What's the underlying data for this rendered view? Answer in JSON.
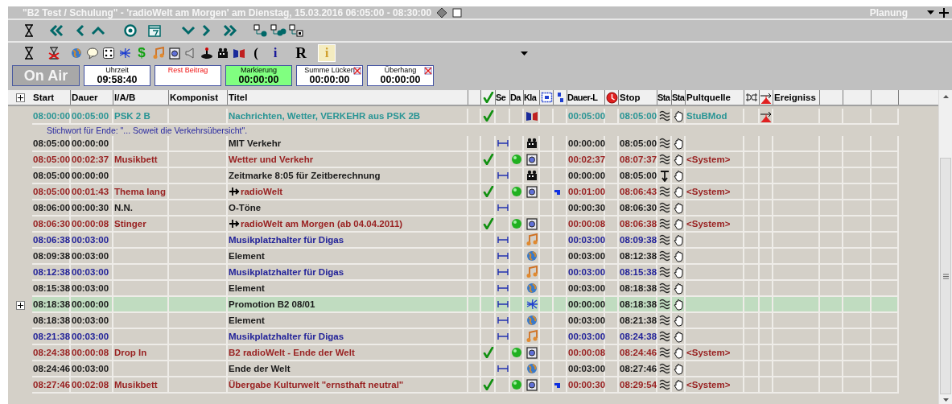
{
  "window": {
    "title": "\"B2 Test / Schulung\" - 'radioWelt am Morgen' am Dienstag, 15.03.2016 06:05:00 - 08:30:00",
    "view": "Planung"
  },
  "toolbar_2": {
    "glyphs": [
      {
        "text": "$",
        "kind": "dollar"
      },
      {
        "text": "(",
        "kind": "paren"
      },
      {
        "text": "i",
        "kind": "info"
      },
      {
        "text": "R",
        "kind": "letter"
      },
      {
        "text": "i",
        "kind": "info-active"
      }
    ]
  },
  "status": {
    "on_air": "On Air",
    "boxes": [
      {
        "label": "Uhrzeit",
        "value": "09:58:40",
        "alert": false,
        "closable": false,
        "color": "#ffffff"
      },
      {
        "label": "Rest Beitrag",
        "alert": true,
        "closable": false,
        "color": "#ffffff"
      },
      {
        "label": "Markierung",
        "value": "00:00:00",
        "alert": false,
        "closable": false,
        "color": "#80ff80"
      },
      {
        "label": "Summe Lücken",
        "value": "00:00:00",
        "alert": false,
        "closable": true,
        "color": "#ffffff"
      },
      {
        "label": "Überhang",
        "value": "00:00:00",
        "alert": false,
        "closable": true,
        "color": "#ffffff"
      }
    ]
  },
  "table": {
    "columns": [
      "Start",
      "Dauer",
      "I/A/B",
      "Komponist",
      "Titel",
      "Se",
      "Da",
      "Kla",
      "Dauer-L",
      "Stop",
      "Sta",
      "Sta",
      "Pultquelle",
      "Ereigniss"
    ],
    "rows": [
      {
        "start": "08:00:00",
        "duration": "00:05:00",
        "iab": "PSK 2 B",
        "title": "Nachrichten, Wetter, VERKEHR aus PSK 2B",
        "color": "#2a9595",
        "linked": false,
        "checked": true,
        "bracket": false,
        "ball": false,
        "class": {
          "kind": "flags"
        },
        "marker": false,
        "dauer_l": "00:05:00",
        "stop": "08:05:00",
        "status": {
          "kind": "wave"
        },
        "pult": "StuBMod",
        "event": true,
        "selected": false,
        "expandable": false,
        "note": "Stichwort für Ende: \"... Soweit die Verkehrsübersicht\"."
      },
      {
        "start": "08:05:00",
        "duration": "00:00:00",
        "title": "MIT Verkehr",
        "color": "#1a1a1a",
        "linked": false,
        "checked": false,
        "bracket": true,
        "ball": false,
        "class": {
          "kind": "film"
        },
        "marker": false,
        "dauer_l": "00:00:00",
        "stop": "08:05:00",
        "status": {
          "kind": "wave"
        },
        "event": false,
        "selected": false,
        "expandable": false
      },
      {
        "start": "08:05:00",
        "duration": "00:02:37",
        "iab": "Musikbett",
        "title": "Wetter und Verkehr",
        "color": "#992222",
        "linked": false,
        "checked": true,
        "bracket": false,
        "ball": true,
        "class": {
          "kind": "speakerbox"
        },
        "marker": false,
        "dauer_l": "00:02:37",
        "stop": "08:07:37",
        "status": {
          "kind": "wave"
        },
        "pult": "<System>",
        "event": false,
        "selected": false,
        "expandable": false
      },
      {
        "start": "08:05:00",
        "duration": "00:00:00",
        "title": "Zeitmarke 8:05 für Zeitberechnung",
        "color": "#1a1a1a",
        "linked": false,
        "checked": false,
        "bracket": true,
        "ball": false,
        "class": {
          "kind": "film"
        },
        "marker": false,
        "dauer_l": "00:00:00",
        "stop": "08:05:00",
        "status": {
          "kind": "timemark"
        },
        "event": false,
        "selected": false,
        "expandable": false
      },
      {
        "start": "08:05:00",
        "duration": "00:01:43",
        "iab": "Thema lang",
        "title": "radioWelt",
        "color": "#992222",
        "linked": true,
        "checked": true,
        "bracket": false,
        "ball": true,
        "class": {
          "kind": "speakerbox"
        },
        "marker": true,
        "dauer_l": "00:01:00",
        "stop": "08:06:43",
        "status": {
          "kind": "wave"
        },
        "pult": "<System>",
        "event": false,
        "selected": false,
        "expandable": false
      },
      {
        "start": "08:06:00",
        "duration": "00:00:30",
        "iab": "N.N.",
        "title": "O-Töne",
        "color": "#1a1a1a",
        "linked": false,
        "checked": false,
        "bracket": true,
        "ball": false,
        "marker": false,
        "dauer_l": "00:00:30",
        "stop": "08:06:30",
        "status": {
          "kind": "wave"
        },
        "event": false,
        "selected": false,
        "expandable": false
      },
      {
        "start": "08:06:30",
        "duration": "00:00:08",
        "iab": "Stinger",
        "title": "radioWelt am Morgen (ab 04.04.2011)",
        "color": "#992222",
        "linked": true,
        "checked": true,
        "bracket": false,
        "ball": true,
        "class": {
          "kind": "speakerbox"
        },
        "marker": false,
        "dauer_l": "00:00:08",
        "stop": "08:06:38",
        "status": {
          "kind": "wave"
        },
        "pult": "<System>",
        "event": false,
        "selected": false,
        "expandable": false
      },
      {
        "start": "08:06:38",
        "duration": "00:03:00",
        "title": "Musikplatzhalter für Digas",
        "color": "#222299",
        "linked": false,
        "checked": false,
        "bracket": true,
        "ball": false,
        "class": {
          "kind": "music"
        },
        "marker": false,
        "dauer_l": "00:03:00",
        "stop": "08:09:38",
        "status": {
          "kind": "wave"
        },
        "event": false,
        "selected": false,
        "expandable": false
      },
      {
        "start": "08:09:38",
        "duration": "00:03:00",
        "title": "Element",
        "color": "#1a1a1a",
        "linked": false,
        "checked": false,
        "bracket": true,
        "ball": false,
        "class": {
          "kind": "globe"
        },
        "marker": false,
        "dauer_l": "00:03:00",
        "stop": "08:12:38",
        "status": {
          "kind": "wave"
        },
        "event": false,
        "selected": false,
        "expandable": false
      },
      {
        "start": "08:12:38",
        "duration": "00:03:00",
        "title": "Musikplatzhalter für Digas",
        "color": "#222299",
        "linked": false,
        "checked": false,
        "bracket": true,
        "ball": false,
        "class": {
          "kind": "music"
        },
        "marker": false,
        "dauer_l": "00:03:00",
        "stop": "08:15:38",
        "status": {
          "kind": "wave"
        },
        "event": false,
        "selected": false,
        "expandable": false
      },
      {
        "start": "08:15:38",
        "duration": "00:03:00",
        "title": "Element",
        "color": "#1a1a1a",
        "linked": false,
        "checked": false,
        "bracket": true,
        "ball": false,
        "class": {
          "kind": "globe"
        },
        "marker": false,
        "dauer_l": "00:03:00",
        "stop": "08:18:38",
        "status": {
          "kind": "wave"
        },
        "event": false,
        "selected": false,
        "expandable": false
      },
      {
        "start": "08:18:38",
        "duration": "00:00:00",
        "title": "Promotion B2 08/01",
        "color": "#1a1a1a",
        "linked": false,
        "checked": false,
        "bracket": true,
        "ball": false,
        "class": {
          "kind": "burst"
        },
        "marker": false,
        "dauer_l": "00:00:00",
        "stop": "08:18:38",
        "status": {
          "kind": "wave"
        },
        "event": false,
        "selected": true,
        "expandable": true
      },
      {
        "start": "08:18:38",
        "duration": "00:03:00",
        "title": "Element",
        "color": "#1a1a1a",
        "linked": false,
        "checked": false,
        "bracket": true,
        "ball": false,
        "class": {
          "kind": "globe"
        },
        "marker": false,
        "dauer_l": "00:03:00",
        "stop": "08:21:38",
        "status": {
          "kind": "wave"
        },
        "event": false,
        "selected": false,
        "expandable": false
      },
      {
        "start": "08:21:38",
        "duration": "00:03:00",
        "title": "Musikplatzhalter für Digas",
        "color": "#222299",
        "linked": false,
        "checked": false,
        "bracket": true,
        "ball": false,
        "class": {
          "kind": "music"
        },
        "marker": false,
        "dauer_l": "00:03:00",
        "stop": "08:24:38",
        "status": {
          "kind": "wave"
        },
        "event": false,
        "selected": false,
        "expandable": false
      },
      {
        "start": "08:24:38",
        "duration": "00:00:08",
        "iab": "Drop In",
        "title": "B2 radioWelt - Ende der Welt",
        "color": "#992222",
        "linked": false,
        "checked": true,
        "bracket": false,
        "ball": true,
        "class": {
          "kind": "speakerbox"
        },
        "marker": false,
        "dauer_l": "00:00:08",
        "stop": "08:24:46",
        "status": {
          "kind": "wave"
        },
        "pult": "<System>",
        "event": false,
        "selected": false,
        "expandable": false
      },
      {
        "start": "08:24:46",
        "duration": "00:03:00",
        "title": "Ende der Welt",
        "color": "#1a1a1a",
        "linked": false,
        "checked": false,
        "bracket": true,
        "ball": false,
        "class": {
          "kind": "globe"
        },
        "marker": false,
        "dauer_l": "00:03:00",
        "stop": "08:27:46",
        "status": {
          "kind": "wave"
        },
        "event": false,
        "selected": false,
        "expandable": false
      },
      {
        "start": "08:27:46",
        "duration": "00:02:08",
        "iab": "Musikbett",
        "title": "Übergabe Kulturwelt \"ernsthaft neutral\"",
        "color": "#992222",
        "linked": false,
        "checked": true,
        "bracket": false,
        "ball": true,
        "class": {
          "kind": "speakerbox"
        },
        "marker": true,
        "dauer_l": "00:00:30",
        "stop": "08:29:54",
        "status": {
          "kind": "wave"
        },
        "pult": "<System>",
        "event": false,
        "selected": false,
        "expandable": false
      }
    ]
  }
}
